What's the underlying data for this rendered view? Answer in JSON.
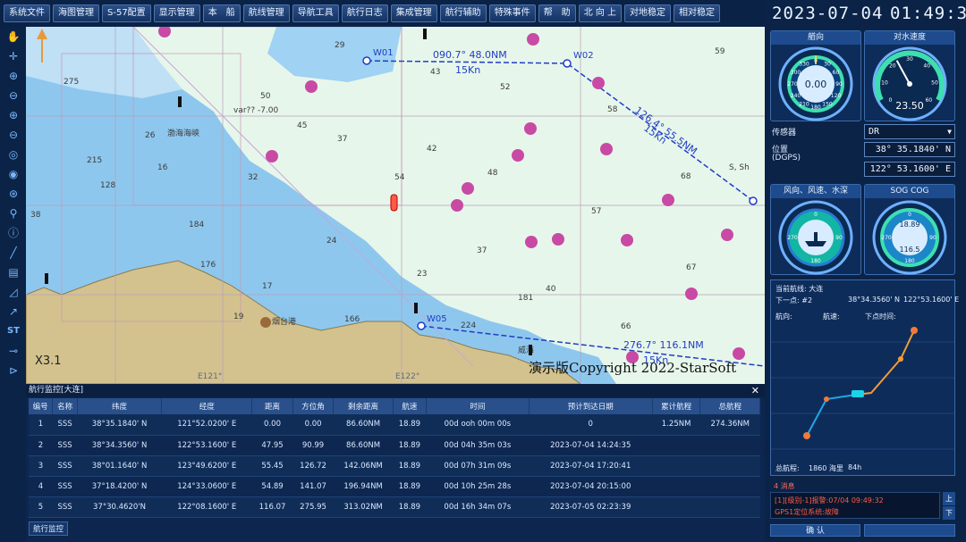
{
  "menu": [
    "系统文件",
    "海图管理",
    "S-57配置",
    "显示管理",
    "本　船",
    "航线管理",
    "导航工具",
    "航行日志",
    "集成管理",
    "航行辅助",
    "特殊事件",
    "帮　助",
    "北 向 上",
    "对地稳定",
    "相对稳定"
  ],
  "datetime": {
    "date": "2023-07-04",
    "time": "01:49:32"
  },
  "map": {
    "scale": "X3.1",
    "watermark": "演示版Copyright 2022-StarSoft",
    "waypoints": [
      "W01",
      "W02",
      "W05"
    ],
    "leg1": "090.7° 48.0NM",
    "leg1_speed": "15Kn",
    "leg2": "126.4° 55.5NM",
    "leg2_speed": "15Kn",
    "leg3": "276.7° 116.1NM",
    "leg3_speed": "15Kn",
    "variation": "var?? -7.00",
    "place1": "渤海海峡",
    "place2": "烟台港",
    "place3": "威海",
    "sshj": "S, Sh",
    "lon1": "E121°",
    "lon2": "E122°",
    "soundings": [
      "275",
      "26",
      "215",
      "128",
      "184",
      "176",
      "17",
      "16",
      "166",
      "23",
      "224",
      "181",
      "29",
      "43",
      "50",
      "45",
      "52",
      "58",
      "59",
      "37",
      "42",
      "32",
      "54",
      "48",
      "57",
      "68",
      "37",
      "40",
      "67",
      "66",
      "24",
      "19",
      "38"
    ]
  },
  "tools": [
    "hand-icon",
    "pan-icon",
    "zoom-in-icon",
    "zoom-out-icon",
    "zoom-plus-icon",
    "zoom-minus-icon",
    "zoom-area-icon",
    "zoom-reset-icon",
    "zoom-ship-icon",
    "pin-icon",
    "info-icon",
    "ruler-icon",
    "measure-icon",
    "angle-icon",
    "line-icon",
    "st-icon",
    "key-icon",
    "route-icon"
  ],
  "st_label": "ST",
  "monitor": {
    "title": "航行监控[大连]",
    "close": "✕",
    "columns": [
      "编号",
      "名称",
      "纬度",
      "经度",
      "距离",
      "方位角",
      "剩余距离",
      "航速",
      "时间",
      "预计到达日期",
      "累计航程",
      "总航程"
    ],
    "rows": [
      [
        "1",
        "SSS",
        "38°35.1840' N",
        "121°52.0200' E",
        "0.00",
        "0.00",
        "86.60NM",
        "18.89",
        "00d ooh 00m 00s",
        "0",
        "1.25NM",
        "274.36NM"
      ],
      [
        "2",
        "SSS",
        "38°34.3560' N",
        "122°53.1600' E",
        "47.95",
        "90.99",
        "86.60NM",
        "18.89",
        "00d 04h 35m 03s",
        "2023-07-04 14:24:35",
        "",
        ""
      ],
      [
        "3",
        "SSS",
        "38°01.1640' N",
        "123°49.6200' E",
        "55.45",
        "126.72",
        "142.06NM",
        "18.89",
        "00d 07h 31m 09s",
        "2023-07-04 17:20:41",
        "",
        ""
      ],
      [
        "4",
        "SSS",
        "37°18.4200' N",
        "124°33.0600' E",
        "54.89",
        "141.07",
        "196.94NM",
        "18.89",
        "00d 10h 25m 28s",
        "2023-07-04 20:15:00",
        "",
        ""
      ],
      [
        "5",
        "SSS",
        "37°30.4620'N",
        "122°08.1600' E",
        "116.07",
        "275.95",
        "313.02NM",
        "18.89",
        "00d 16h 34m 07s",
        "2023-07-05 02:23:39",
        "",
        ""
      ]
    ],
    "tab": "航行监控"
  },
  "gauges": {
    "heading": {
      "title": "艏向",
      "value": "0.00",
      "ticks": [
        "0",
        "30",
        "60",
        "90",
        "120",
        "150",
        "180",
        "210",
        "240",
        "270",
        "300",
        "330"
      ]
    },
    "speed": {
      "title": "对水速度",
      "value": "23.50",
      "ticks": [
        "0",
        "10",
        "20",
        "30",
        "40",
        "50",
        "60"
      ],
      "speed_fraction": 0.39
    },
    "wind": {
      "title": "风向、风速、水深",
      "ticks": [
        "0",
        "90",
        "180",
        "270"
      ]
    },
    "sog": {
      "title": "SOG COG",
      "value": "18.89",
      "value2": "116.5",
      "ticks": [
        "0",
        "90",
        "180",
        "270"
      ]
    }
  },
  "sensor": {
    "label": "传感器",
    "value": "DR",
    "pos_label": "位置",
    "pos_sub": "(DGPS)",
    "lat": "38° 35.1840' N",
    "lon": "122° 53.1600' E"
  },
  "route": {
    "current": "当前航线: 大连",
    "next": "下一点: #2",
    "next_lat": "38°34.3560' N",
    "next_lon": "122°53.1600' E",
    "h1": "航向:",
    "h2": "航速:",
    "h3": "下点时间:",
    "total": "总航程:",
    "total_val": "1860 海里",
    "total_hours": "84h"
  },
  "messages": {
    "count": "4 消息",
    "line1": "[1][级别-1]报警:07/04 09:49:32",
    "line2": "GPS1定位系统:故障",
    "up": "上",
    "down": "下",
    "ok": "确  认"
  }
}
